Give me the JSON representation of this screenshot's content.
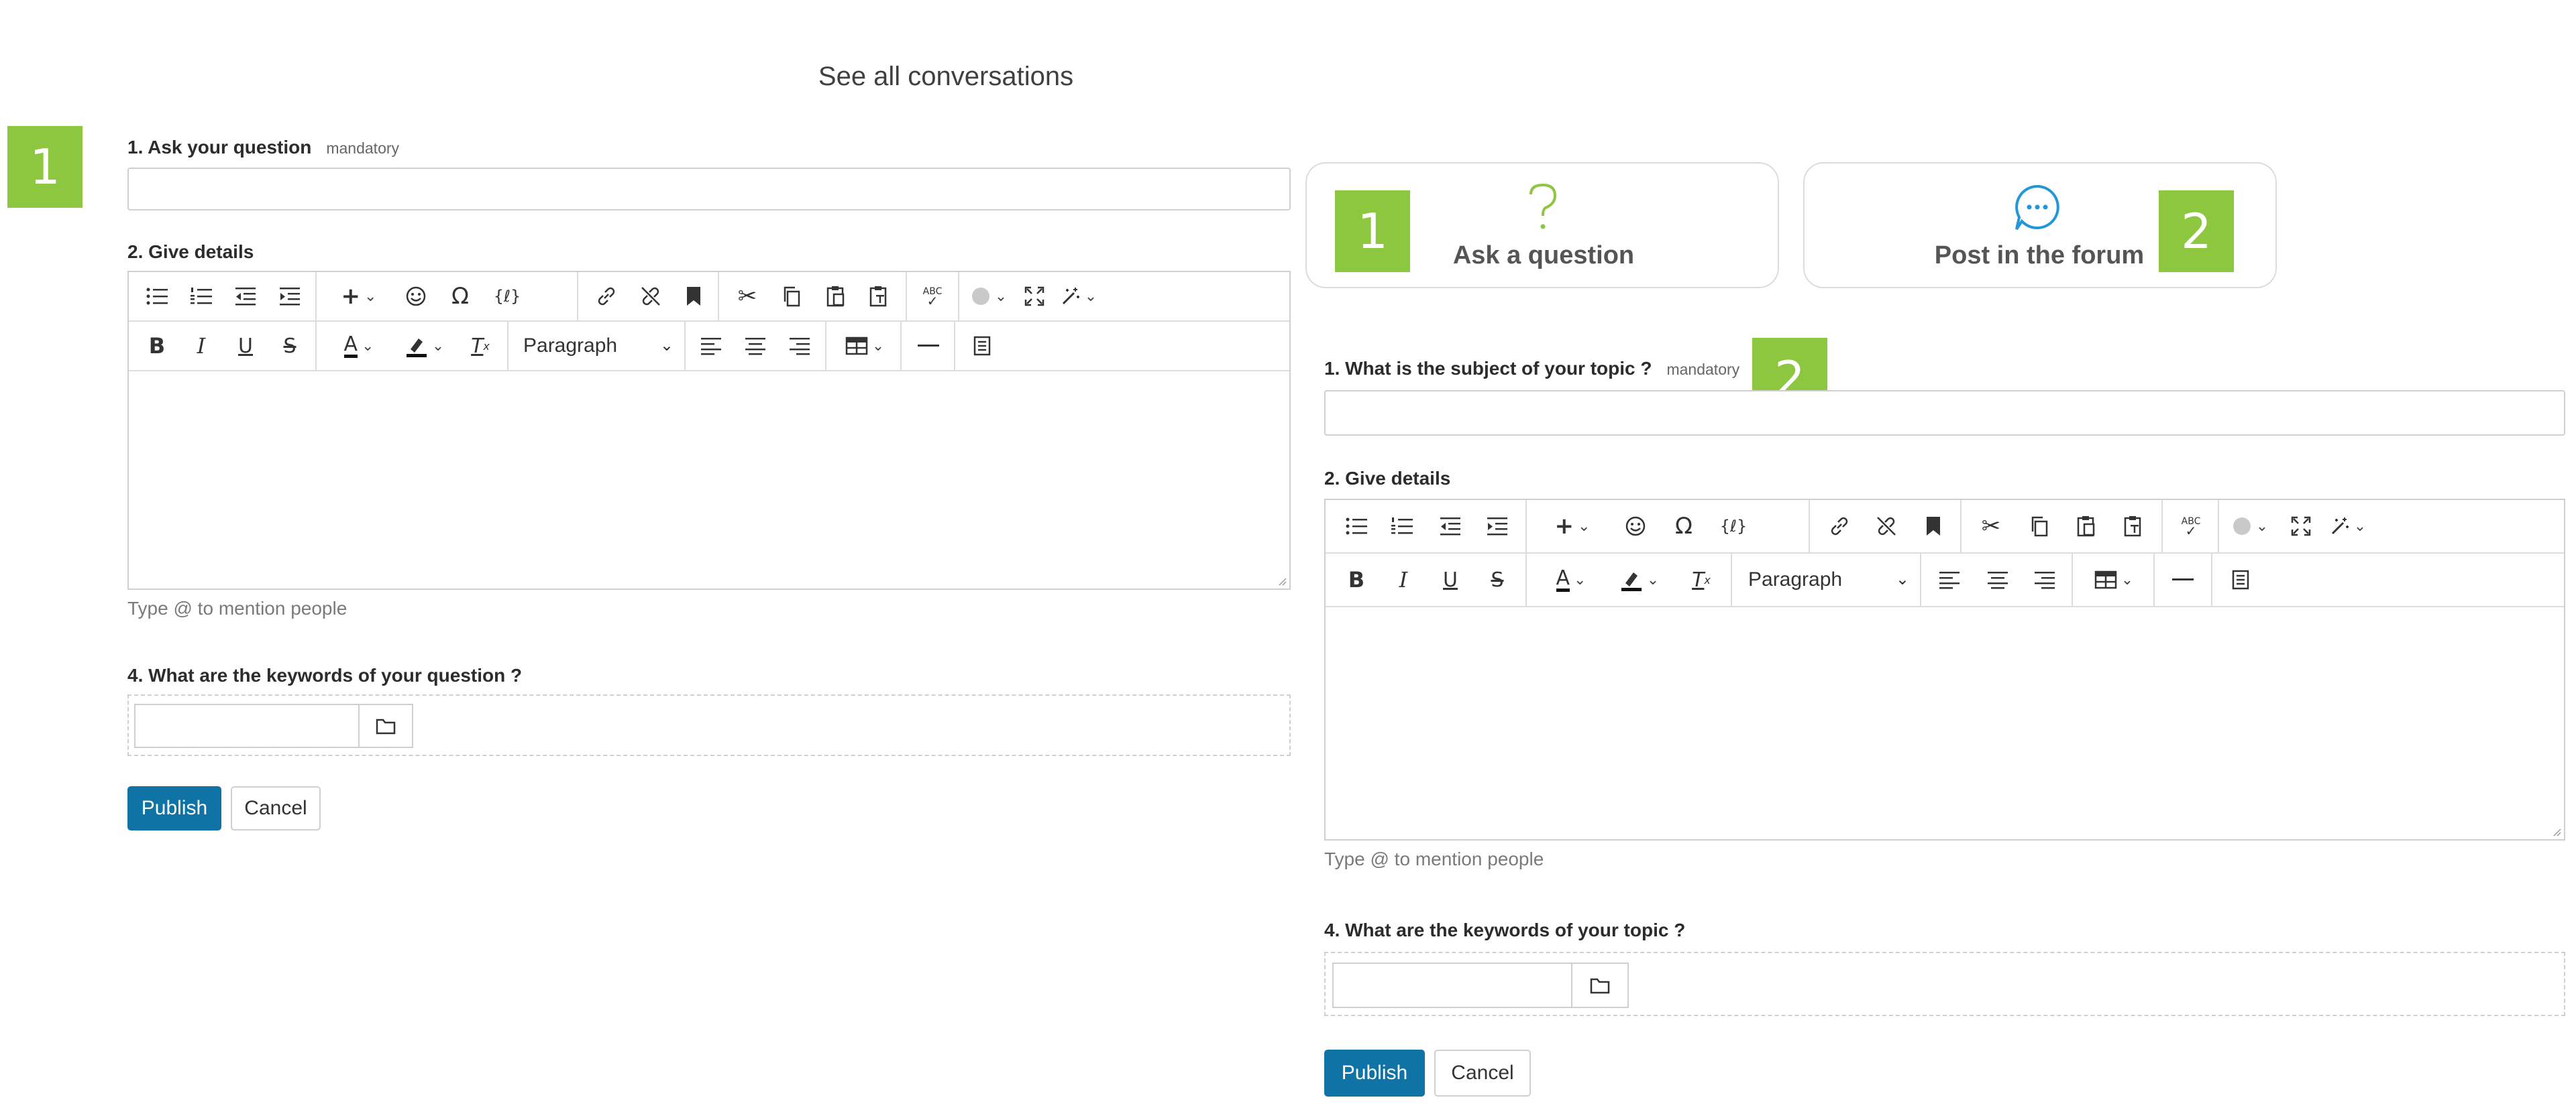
{
  "header": {
    "title": "See all conversations"
  },
  "colors": {
    "badge": "#8dc63f",
    "primary": "#1073a6",
    "border": "#cfcfcf",
    "question_icon": "#8dc63f",
    "forum_icon": "#2196d9"
  },
  "left_form": {
    "badge": "1",
    "question_label": "1. Ask your question",
    "mandatory": "mandatory",
    "details_label": "2. Give details",
    "paragraph_select": "Paragraph",
    "mention_hint": "Type @ to mention people",
    "keywords_label": "4. What are the keywords of your question ?",
    "publish": "Publish",
    "cancel": "Cancel"
  },
  "type_cards": [
    {
      "badge": "1",
      "label": "Ask a question",
      "icon": "question-mark-icon"
    },
    {
      "badge": "2",
      "label": "Post in the forum",
      "icon": "chat-bubble-icon"
    }
  ],
  "right_form": {
    "badge": "2",
    "subject_label": "1. What is the subject of your topic ?",
    "mandatory": "mandatory",
    "details_label": "2. Give details",
    "paragraph_select": "Paragraph",
    "mention_hint": "Type @ to mention people",
    "keywords_label": "4. What are the keywords of your topic ?",
    "publish": "Publish",
    "cancel": "Cancel"
  },
  "toolbar": {
    "row1": [
      "bulleted-list-icon",
      "numbered-list-icon",
      "outdent-icon",
      "indent-icon",
      "insert-plus-icon",
      "emoji-icon",
      "omega-special-char-icon",
      "code-braces-icon",
      "link-icon",
      "unlink-icon",
      "bookmark-icon",
      "cut-icon",
      "copy-icon",
      "paste-icon",
      "paste-text-icon",
      "spellcheck-abc-icon",
      "language-icon",
      "fullscreen-icon",
      "magic-wand-icon"
    ],
    "row2": [
      "bold-icon",
      "italic-icon",
      "underline-icon",
      "strikethrough-icon",
      "text-color-icon",
      "highlight-icon",
      "clear-format-icon",
      "align-left-icon",
      "align-center-icon",
      "align-right-icon",
      "table-icon",
      "horizontal-rule-icon",
      "source-document-icon"
    ]
  }
}
